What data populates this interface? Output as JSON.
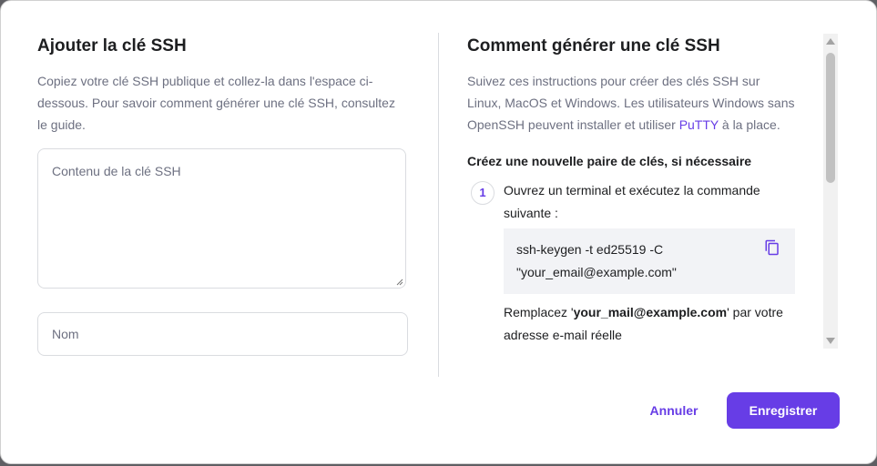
{
  "left": {
    "title": "Ajouter la clé SSH",
    "description": "Copiez votre clé SSH publique et collez-la dans l'espace ci-dessous. Pour savoir comment générer une clé SSH, consultez le guide.",
    "key_placeholder": "Contenu de la clé SSH",
    "name_placeholder": "Nom"
  },
  "right": {
    "title": "Comment générer une clé SSH",
    "description_before": "Suivez ces instructions pour créer des clés SSH sur Linux, MacOS et Windows. Les utilisateurs Windows sans OpenSSH peuvent installer et utiliser ",
    "putty_link": "PuTTY",
    "description_after": " à la place.",
    "subheading": "Créez une nouvelle paire de clés, si nécessaire",
    "steps": [
      {
        "number": "1",
        "text": "Ouvrez un terminal et exécutez la commande suivante :",
        "code_line1": "ssh-keygen -t ed25519 -C",
        "code_line2": "\"your_email@example.com\"",
        "note_before": "Remplacez '",
        "note_bold": "your_mail@example.com",
        "note_after": "' par votre adresse e-mail réelle"
      }
    ]
  },
  "footer": {
    "cancel_label": "Annuler",
    "save_label": "Enregistrer"
  },
  "colors": {
    "accent": "#673de6",
    "text": "#1d1e20",
    "muted": "#6d7081"
  }
}
